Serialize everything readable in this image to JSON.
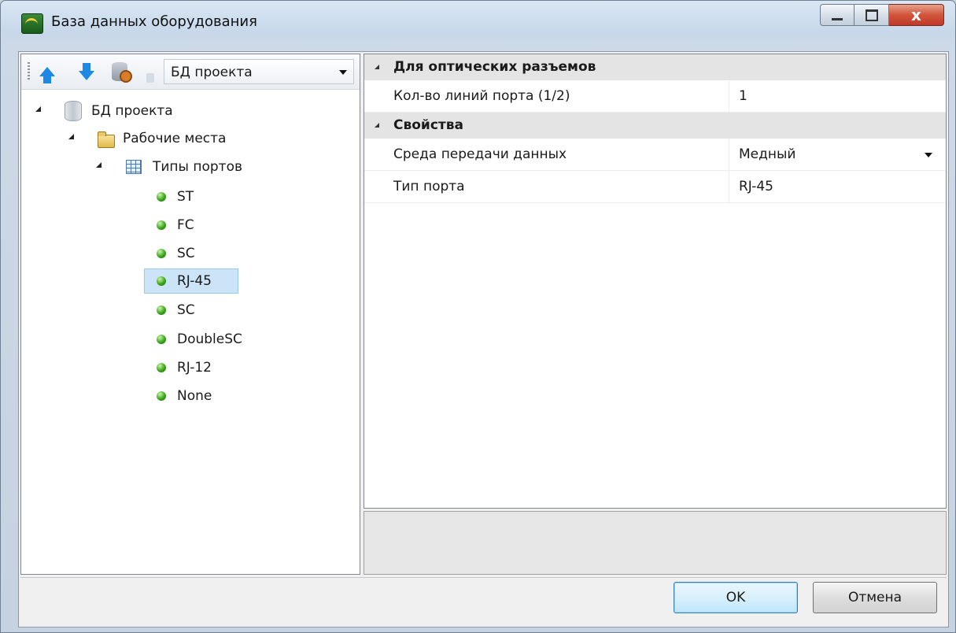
{
  "window": {
    "title": "База данных оборудования",
    "close_glyph": "x"
  },
  "toolbar": {
    "move_up_icon": "arrow-up-icon",
    "move_down_icon": "arrow-down-icon",
    "db_settings_icon": "database-gear-icon",
    "db_select": {
      "selected": "БД проекта"
    }
  },
  "tree": {
    "root": {
      "label": "БД проекта",
      "icon": "database-icon"
    },
    "folder": {
      "label": "Рабочие места",
      "icon": "folder-icon"
    },
    "table": {
      "label": "Типы портов",
      "icon": "table-icon"
    },
    "items": [
      {
        "label": "ST"
      },
      {
        "label": "FC"
      },
      {
        "label": "SC"
      },
      {
        "label": "RJ-45",
        "selected": true
      },
      {
        "label": "SC"
      },
      {
        "label": "DoubleSC"
      },
      {
        "label": "RJ-12"
      },
      {
        "label": "None"
      }
    ]
  },
  "properties": {
    "categories": [
      {
        "title": "Для оптических разъемов",
        "rows": [
          {
            "name": "Кол-во линий порта (1/2)",
            "value": "1"
          }
        ]
      },
      {
        "title": "Свойства",
        "rows": [
          {
            "name": "Среда передачи данных",
            "value": "Медный",
            "dropdown": true
          },
          {
            "name": "Тип порта",
            "value": "RJ-45"
          }
        ]
      }
    ]
  },
  "buttons": {
    "ok": "OK",
    "cancel": "Отмена"
  },
  "colors": {
    "selection": "#cce4f7",
    "status_dot": "#3aa51a",
    "close_button": "#c0392b"
  }
}
